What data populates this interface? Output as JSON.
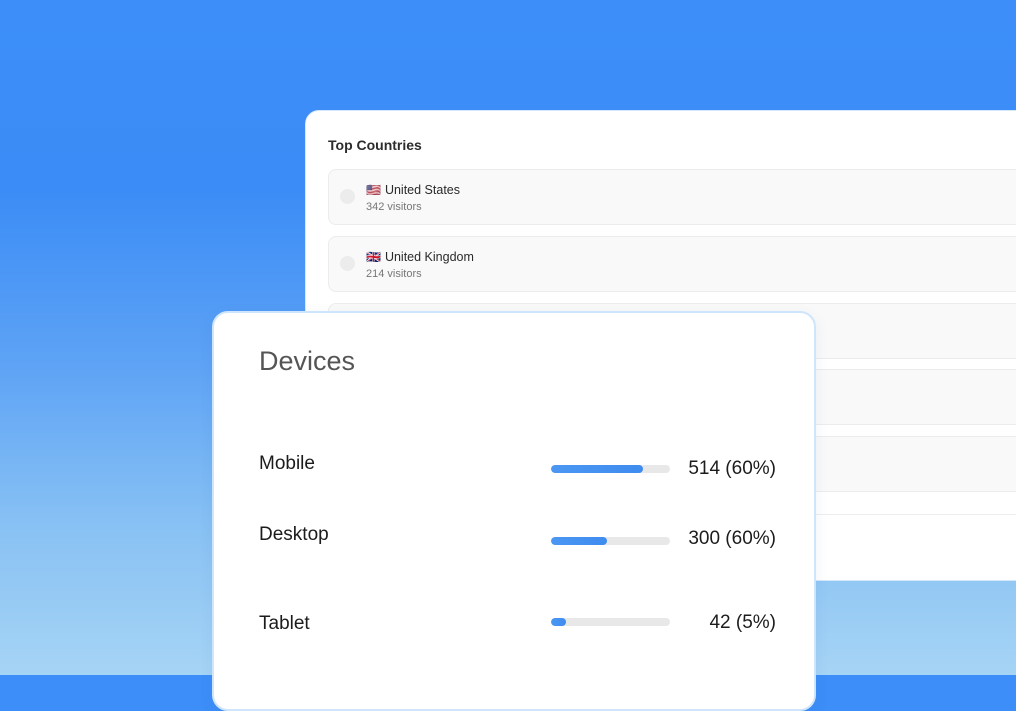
{
  "countries": {
    "title": "Top Countries",
    "items": [
      {
        "flag": "🇺🇸",
        "name": "United States",
        "visitors": "342 visitors"
      },
      {
        "flag": "🇬🇧",
        "name": "United Kingdom",
        "visitors": "214 visitors"
      }
    ]
  },
  "devices": {
    "title": "Devices",
    "items": [
      {
        "label": "Mobile",
        "value": "514 (60%)",
        "fill_fraction": 0.77
      },
      {
        "label": "Desktop",
        "value": "300 (60%)",
        "fill_fraction": 0.47
      },
      {
        "label": "Tablet",
        "value": "42 (5%)",
        "fill_fraction": 0.13
      }
    ]
  }
}
